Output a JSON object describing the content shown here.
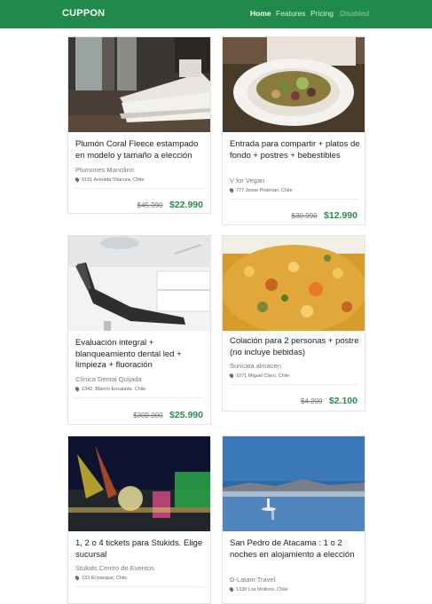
{
  "navbar": {
    "brand": "CUPPON",
    "links": [
      {
        "label": "Home",
        "state": "active"
      },
      {
        "label": "Features",
        "state": "normal"
      },
      {
        "label": "Pricing",
        "state": "normal"
      },
      {
        "label": "Disabled",
        "state": "disabled"
      }
    ]
  },
  "colors": {
    "navbar": "#1f8a4c",
    "price": "#2d8a53"
  },
  "deals": [
    {
      "title": "Plumón Coral Fleece estampado en modelo y tamaño a elección",
      "merchant": "Plumones Manolino",
      "address": "9191 Avenida Vitacura, Chile",
      "old_price": "$45.990",
      "new_price": "$22.990",
      "image": "bedroom-photo"
    },
    {
      "title": "Entrada para compartir + platos de fondo + postres + bebestibles",
      "merchant": "V for Vegan",
      "address": "777 Jesse Pinkman, Chile",
      "old_price": "$30.990",
      "new_price": "$12.990",
      "image": "salad-plate-photo"
    },
    {
      "title": "Evaluación integral + blanqueamiento dental led + limpieza + fluoración",
      "merchant": "Clínica Dental Quijada",
      "address": "1342, Blanco Encalada, Chile",
      "old_price": "$300.000",
      "new_price": "$25.990",
      "image": "dental-chair-photo"
    },
    {
      "title": "Colación para 2 personas + postre (no incluye bebidas)",
      "merchant": "Suricata almacen",
      "address": "1071 Miguel Claro, Chile",
      "old_price": "$4.200",
      "new_price": "$2.100",
      "image": "stew-photo"
    },
    {
      "title": "1, 2 o 4 tickets para Stukids. Elige sucursal",
      "merchant": "Stukids Centro de Eventos",
      "address": "133 El tranque, Chile",
      "old_price": "",
      "new_price": "",
      "image": "fair-rides-photo"
    },
    {
      "title": "San Pedro de Atacama : 1 o 2 noches en alojamiento a elección",
      "merchant": "D-Latam Travel",
      "address": "1330 Los Molinos, Chile",
      "old_price": "",
      "new_price": "",
      "image": "salt-flat-photo"
    }
  ]
}
